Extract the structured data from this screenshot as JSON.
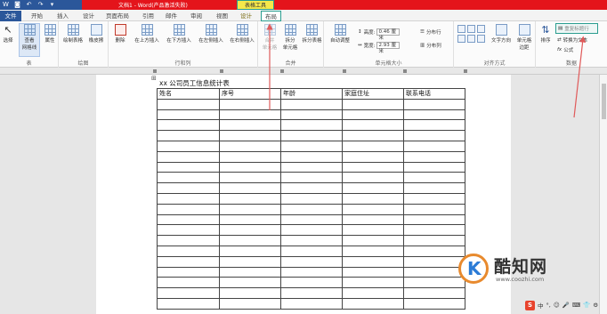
{
  "window": {
    "title": "文档1 - Word(产品激活失败)",
    "context_tool": "表格工具",
    "qat": [
      "W",
      "◙",
      "↶",
      "↷",
      "▾"
    ]
  },
  "tabs": [
    "文件",
    "开始",
    "插入",
    "设计",
    "页面布局",
    "引用",
    "邮件",
    "审阅",
    "视图",
    "设计",
    "布局"
  ],
  "ribbon": {
    "groups": {
      "table": {
        "label": "表",
        "buttons": [
          "选择",
          "查看\n网格线",
          "属性"
        ]
      },
      "draw": {
        "label": "绘图",
        "buttons": [
          "绘制表格",
          "橡皮擦"
        ]
      },
      "rowscols": {
        "label": "行和列",
        "buttons": [
          "删除",
          "在上方插入",
          "在下方插入",
          "在左侧插入",
          "在右侧插入"
        ]
      },
      "merge": {
        "label": "合并",
        "buttons": [
          "合并\n单元格",
          "拆分\n单元格",
          "拆分表格"
        ]
      },
      "cellsize": {
        "label": "单元格大小",
        "autofit": "自动调整",
        "height_label": "高度:",
        "height_value": "0.46 厘米",
        "width_label": "宽度:",
        "width_value": "2.93 厘米",
        "dist_rows": "分布行",
        "dist_cols": "分布列"
      },
      "alignment": {
        "label": "对齐方式",
        "buttons": [
          "文字方向",
          "单元格\n边距"
        ]
      },
      "data": {
        "label": "数据",
        "sort": "排序",
        "repeat_header": "重复标题行",
        "convert": "转换为文本",
        "formula": "公式"
      }
    }
  },
  "document": {
    "table_title": "xx 公司员工信息统计表",
    "headers": [
      "姓名",
      "序号",
      "年龄",
      "家庭住址",
      "联系电话"
    ],
    "empty_rows": 20
  },
  "watermark": {
    "name": "酷知网",
    "url": "www.coozhi.com"
  },
  "tray": {
    "s_icon": "S",
    "items": [
      "中",
      "°,",
      "☺",
      "🎤",
      "⌨",
      "👕",
      "⚙"
    ]
  },
  "colors": {
    "title_blue": "#2b579a",
    "red_band": "#e4141b",
    "highlight_teal": "#2a9d8f",
    "tool_yellow": "#f5e84a"
  }
}
